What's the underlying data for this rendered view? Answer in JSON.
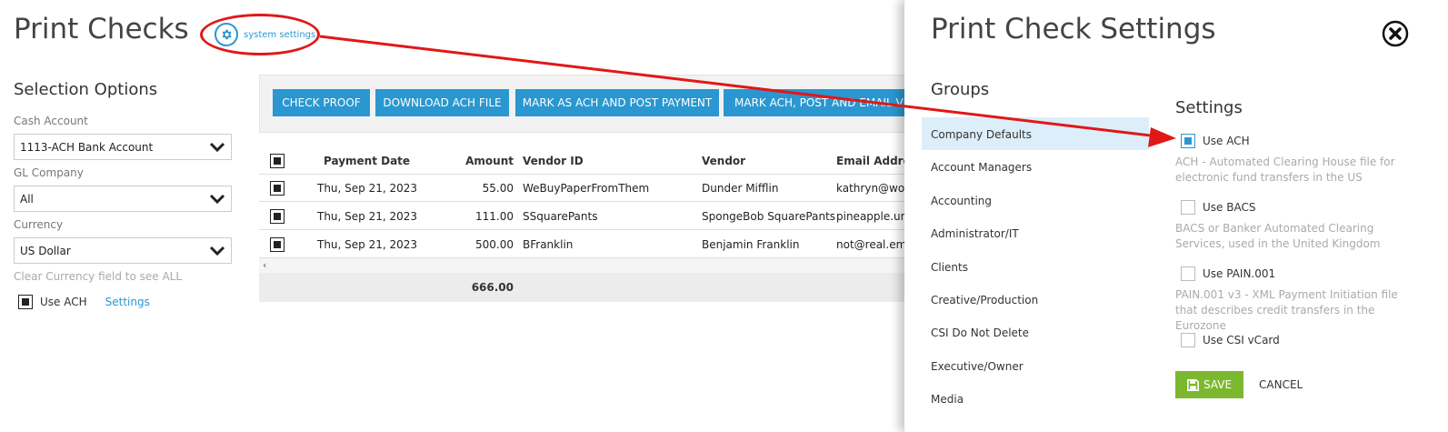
{
  "page": {
    "title": "Print Checks",
    "system_settings_link": "system settings",
    "selection_title": "Selection Options",
    "cash_account_label": "Cash Account",
    "cash_account_value": "1113-ACH Bank Account",
    "gl_company_label": "GL Company",
    "gl_company_value": "All",
    "currency_label": "Currency",
    "currency_value": "US Dollar",
    "currency_hint": "Clear Currency field to see ALL",
    "use_ach_label": "Use ACH",
    "settings_link": "Settings"
  },
  "toolbar": {
    "buttons": [
      "CHECK PROOF",
      "DOWNLOAD ACH FILE",
      "MARK AS ACH AND POST PAYMENT",
      "MARK ACH, POST AND EMAIL VEN"
    ]
  },
  "grid": {
    "columns": [
      "Payment Date",
      "Amount",
      "Vendor ID",
      "Vendor",
      "Email Addres"
    ],
    "rows": [
      [
        "Thu, Sep 21, 2023",
        "55.00",
        "WeBuyPaperFromThem",
        "Dunder Mifflin",
        "kathryn@wor"
      ],
      [
        "Thu, Sep 21, 2023",
        "111.00",
        "SSquarePants",
        "SpongeBob SquarePants",
        "pineapple.und"
      ],
      [
        "Thu, Sep 21, 2023",
        "500.00",
        "BFranklin",
        "Benjamin Franklin",
        "not@real.ema"
      ]
    ],
    "total": "666.00"
  },
  "panel": {
    "title": "Print Check Settings",
    "groups_title": "Groups",
    "groups": [
      "Company Defaults",
      "Account Managers",
      "Accounting",
      "Administrator/IT",
      "Clients",
      "Creative/Production",
      "CSI Do Not Delete",
      "Executive/Owner",
      "Media"
    ],
    "active_group": "Company Defaults",
    "settings_title": "Settings",
    "options": [
      {
        "label": "Use ACH",
        "checked": true,
        "description": "ACH - Automated Clearing House file for electronic fund transfers in the US"
      },
      {
        "label": "Use BACS",
        "checked": false,
        "description": "BACS or Banker Automated Clearing Services, used in the United Kingdom"
      },
      {
        "label": "Use PAIN.001",
        "checked": false,
        "description": "PAIN.001 v3 - XML Payment Initiation file that describes credit transfers in the Eurozone"
      },
      {
        "label": "Use CSI vCard",
        "checked": false,
        "description": ""
      }
    ],
    "save_label": "SAVE",
    "cancel_label": "CANCEL"
  },
  "colors": {
    "accent": "#2a97d0",
    "save": "#7cb82f",
    "annotation": "#e01818",
    "active_group_bg": "#dceef9"
  },
  "icons": {
    "system_settings": "gear-icon",
    "dropdown": "chevron-down-icon",
    "close": "close-circle-icon",
    "save": "save-icon",
    "scroll_left": "scroll-left-icon"
  }
}
